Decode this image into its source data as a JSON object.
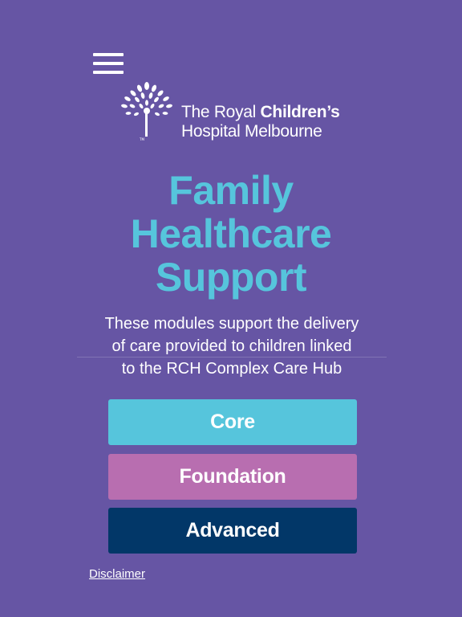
{
  "header": {
    "menu_icon": "hamburger-menu-icon",
    "logo": {
      "icon": "tree-logo-icon",
      "line1_regular": "The Royal ",
      "line1_bold": "Children’s",
      "line2": "Hospital Melbourne",
      "trademark": "TM"
    }
  },
  "main": {
    "title_lines": [
      "Family",
      "Healthcare",
      "Support"
    ],
    "intro_lines": [
      "These modules support the delivery",
      "of care provided to children linked",
      "to the RCH Complex Care Hub"
    ],
    "modules": [
      {
        "label": "Core",
        "color": "#56c5dc"
      },
      {
        "label": "Foundation",
        "color": "#b86eb0"
      },
      {
        "label": "Advanced",
        "color": "#023768"
      }
    ]
  },
  "footer": {
    "disclaimer_label": "Disclaimer"
  },
  "colors": {
    "background": "#6655a4",
    "title": "#56c5dc",
    "text": "#ffffff"
  }
}
